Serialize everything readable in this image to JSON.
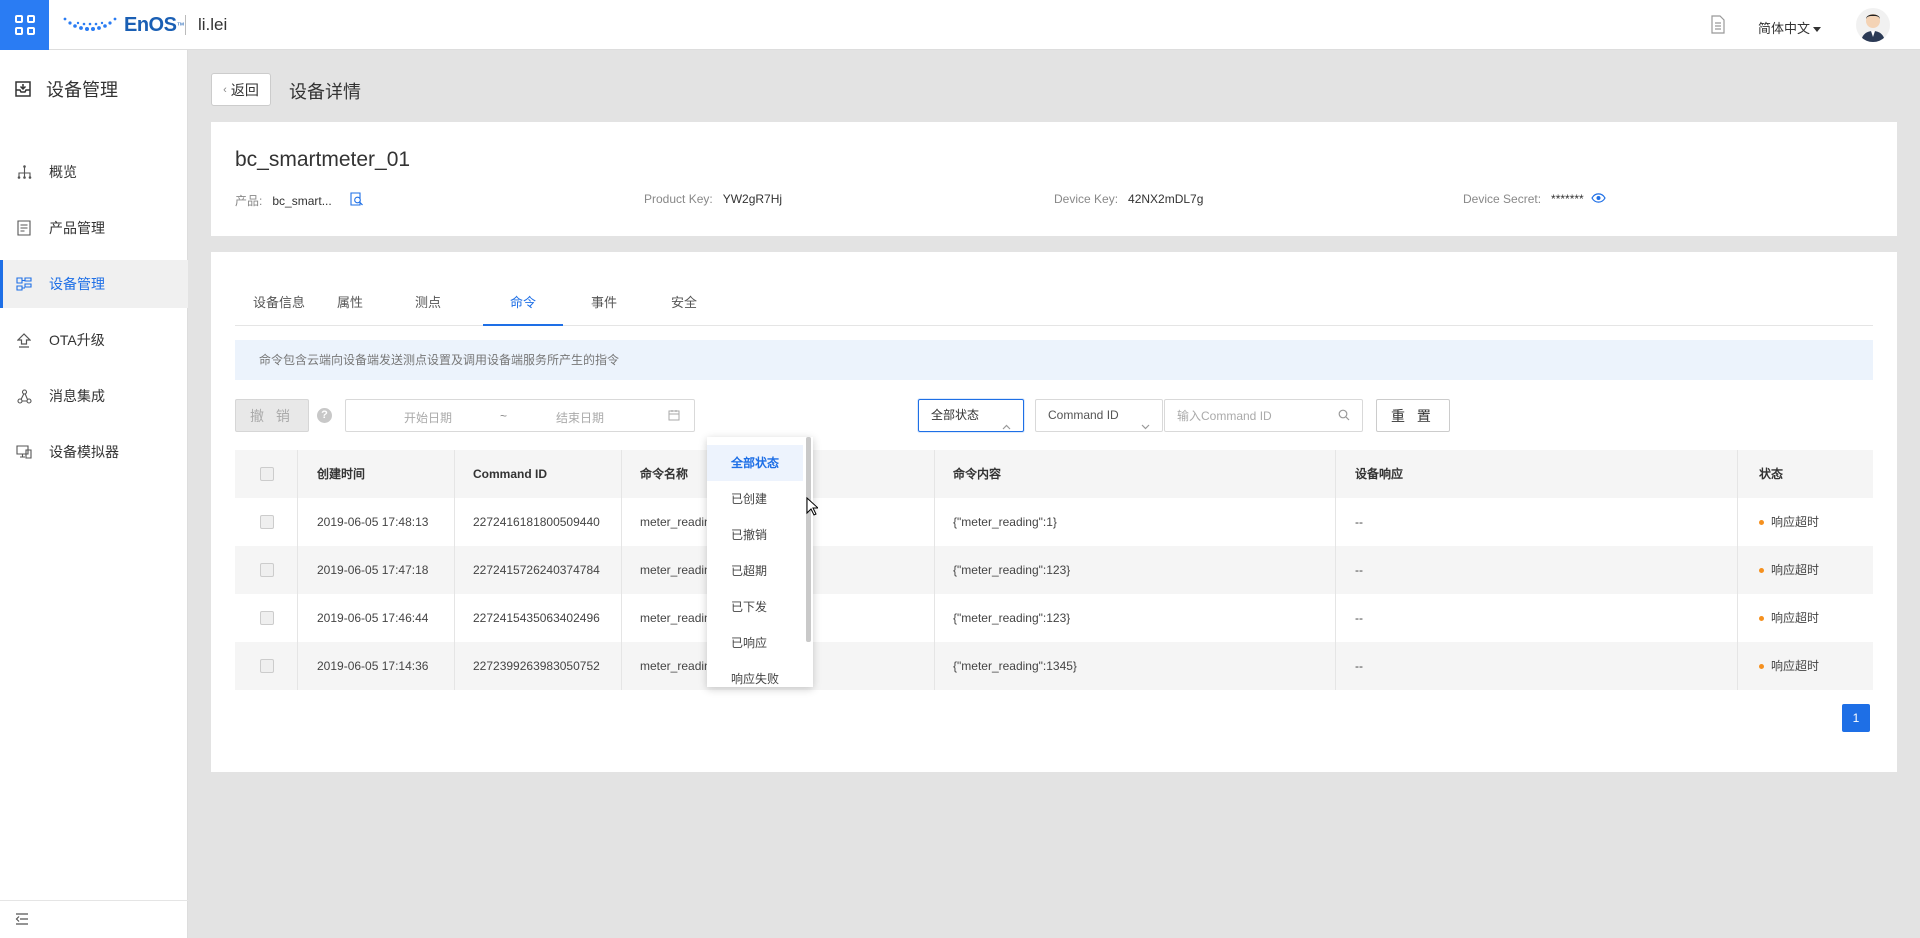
{
  "header": {
    "logo_text": "EnOS",
    "logo_tm": "™",
    "username": "li.lei",
    "language": "简体中文"
  },
  "sidebar": {
    "title": "设备管理",
    "items": [
      {
        "label": "概览",
        "icon": "sitemap-icon",
        "active": false
      },
      {
        "label": "产品管理",
        "icon": "product-icon",
        "active": false
      },
      {
        "label": "设备管理",
        "icon": "device-icon",
        "active": true
      },
      {
        "label": "OTA升级",
        "icon": "upgrade-icon",
        "active": false
      },
      {
        "label": "消息集成",
        "icon": "integration-icon",
        "active": false
      },
      {
        "label": "设备模拟器",
        "icon": "simulator-icon",
        "active": false
      }
    ]
  },
  "page": {
    "back_label": "返回",
    "title": "设备详情"
  },
  "device": {
    "name": "bc_smartmeter_01",
    "product_label": "产品:",
    "product_value": "bc_smart...",
    "product_key_label": "Product Key:",
    "product_key_value": "YW2gR7Hj",
    "device_key_label": "Device Key:",
    "device_key_value": "42NX2mDL7g",
    "device_secret_label": "Device Secret:",
    "device_secret_value": "*******"
  },
  "tabs": [
    "设备信息",
    "属性",
    "测点",
    "命令",
    "事件",
    "安全"
  ],
  "active_tab": "命令",
  "info_text": "命令包含云端向设备端发送测点设置及调用设备端服务所产生的指令",
  "filters": {
    "cancel_label": "撤 销",
    "help": "?",
    "start_date_placeholder": "开始日期",
    "range_sep": "~",
    "end_date_placeholder": "结束日期",
    "status_value": "全部状态",
    "command_select_value": "Command ID",
    "command_input_placeholder": "输入Command ID",
    "reset_label": "重 置"
  },
  "table": {
    "headers": [
      "创建时间",
      "Command ID",
      "命令名称",
      "命令内容",
      "设备响应",
      "状态"
    ],
    "rows": [
      {
        "time": "2019-06-05 17:48:13",
        "command_id": "2272416181800509440",
        "name": "meter_readin",
        "content": "{\"meter_reading\":1}",
        "response": "--",
        "status": "响应超时"
      },
      {
        "time": "2019-06-05 17:47:18",
        "command_id": "2272415726240374784",
        "name": "meter_readin",
        "content": "{\"meter_reading\":123}",
        "response": "--",
        "status": "响应超时"
      },
      {
        "time": "2019-06-05 17:46:44",
        "command_id": "2272415435063402496",
        "name": "meter_readin",
        "content": "{\"meter_reading\":123}",
        "response": "--",
        "status": "响应超时"
      },
      {
        "time": "2019-06-05 17:14:36",
        "command_id": "2272399263983050752",
        "name": "meter_readin",
        "content": "{\"meter_reading\":1345}",
        "response": "--",
        "status": "响应超时"
      }
    ]
  },
  "pagination": {
    "current": "1"
  },
  "status_dropdown": {
    "options": [
      "全部状态",
      "已创建",
      "已撤销",
      "已超期",
      "已下发",
      "已响应",
      "响应失败"
    ],
    "selected": "全部状态"
  },
  "colors": {
    "primary": "#1e6fe6",
    "apps_button": "#2a7cf3",
    "status_dot": "#f5901e",
    "info_bg": "#ecf3fc"
  }
}
